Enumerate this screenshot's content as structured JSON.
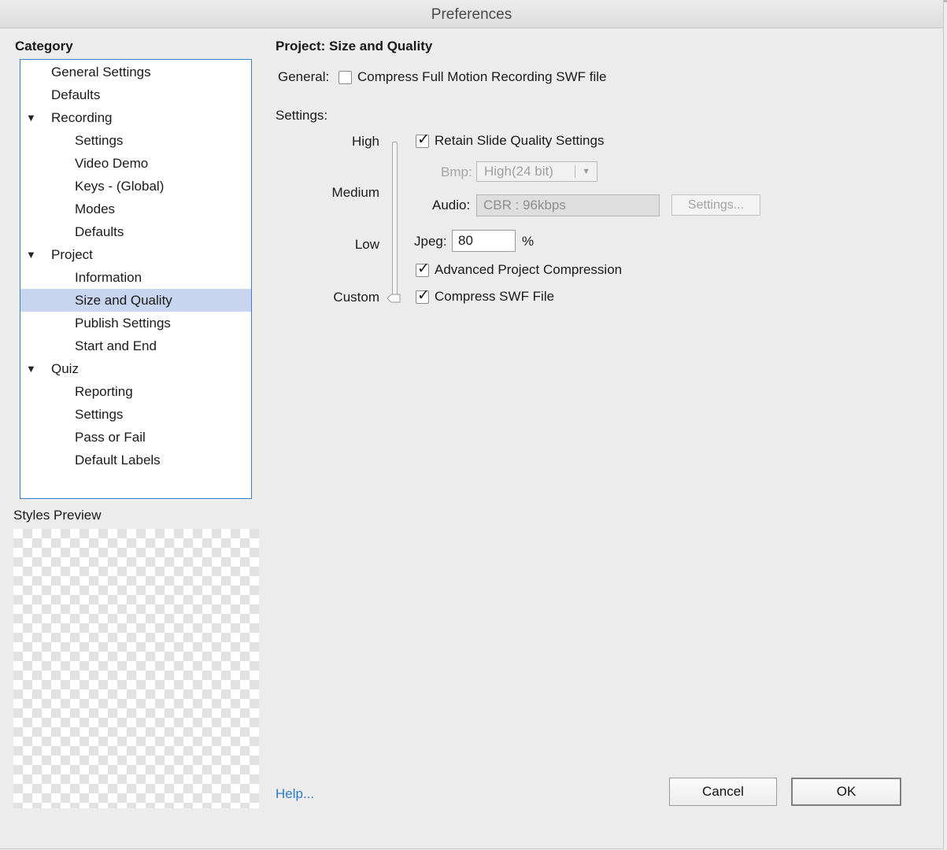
{
  "window": {
    "title": "Preferences"
  },
  "category": {
    "heading": "Category",
    "items": [
      {
        "label": "General Settings",
        "level": 1,
        "expander": false
      },
      {
        "label": "Defaults",
        "level": 1,
        "expander": false
      },
      {
        "label": "Recording",
        "level": 1,
        "expander": true
      },
      {
        "label": "Settings",
        "level": 2,
        "expander": false
      },
      {
        "label": "Video Demo",
        "level": 2,
        "expander": false
      },
      {
        "label": "Keys - (Global)",
        "level": 2,
        "expander": false
      },
      {
        "label": "Modes",
        "level": 2,
        "expander": false
      },
      {
        "label": "Defaults",
        "level": 2,
        "expander": false
      },
      {
        "label": "Project",
        "level": 1,
        "expander": true
      },
      {
        "label": "Information",
        "level": 2,
        "expander": false
      },
      {
        "label": "Size and Quality",
        "level": 2,
        "expander": false,
        "selected": true
      },
      {
        "label": "Publish Settings",
        "level": 2,
        "expander": false
      },
      {
        "label": "Start and End",
        "level": 2,
        "expander": false
      },
      {
        "label": "Quiz",
        "level": 1,
        "expander": true
      },
      {
        "label": "Reporting",
        "level": 2,
        "expander": false
      },
      {
        "label": "Settings",
        "level": 2,
        "expander": false
      },
      {
        "label": "Pass or Fail",
        "level": 2,
        "expander": false
      },
      {
        "label": "Default Labels",
        "level": 2,
        "expander": false
      }
    ],
    "expander_glyph": "▼"
  },
  "styles_preview": {
    "label": "Styles Preview"
  },
  "panel": {
    "title": "Project: Size and Quality",
    "general_label": "General:",
    "compress_fmr": {
      "label": "Compress Full Motion Recording SWF file",
      "checked": false
    },
    "settings_label": "Settings:",
    "slider": {
      "levels": [
        "High",
        "Medium",
        "Low",
        "Custom"
      ],
      "value": "Custom"
    },
    "retain": {
      "label": "Retain Slide Quality Settings",
      "checked": true
    },
    "bmp": {
      "label": "Bmp:",
      "value": "High(24 bit)",
      "disabled": true
    },
    "audio": {
      "label": "Audio:",
      "value": "CBR : 96kbps",
      "settings_button": "Settings..."
    },
    "jpeg": {
      "label": "Jpeg:",
      "value": "80",
      "unit": "%"
    },
    "advanced": {
      "label": "Advanced Project Compression",
      "checked": true
    },
    "compress_swf": {
      "label": "Compress SWF File",
      "checked": true
    }
  },
  "footer": {
    "help": "Help...",
    "cancel": "Cancel",
    "ok": "OK"
  },
  "icons": {
    "check": "✓",
    "dropdown": "▼"
  },
  "colors": {
    "selection": "#c7d5ee",
    "tree_border": "#3a7fc7",
    "link": "#2e7ad1"
  }
}
